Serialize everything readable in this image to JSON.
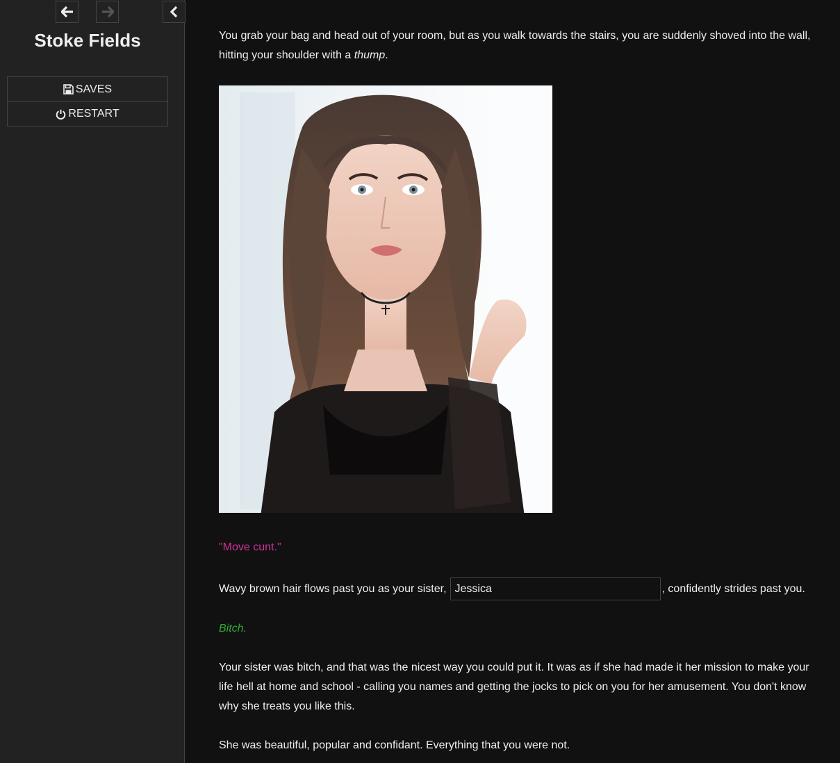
{
  "sidebar": {
    "story_title": "Stoke Fields",
    "nav": {
      "back_icon": "arrow-left-icon",
      "forward_icon": "arrow-right-icon",
      "toggle_icon": "chevron-left-icon"
    },
    "menu": [
      {
        "label": "SAVES",
        "icon": "floppy-disk-icon"
      },
      {
        "label": "RESTART",
        "icon": "power-icon"
      }
    ]
  },
  "passage": {
    "intro_before": "You grab your bag and head out of your room, but as you walk towards the stairs, you are suddenly shoved into the wall, hitting your shoulder with a ",
    "intro_emphasis": "thump",
    "intro_after": ".",
    "quote": "\"Move cunt.\"",
    "name_line_before": "Wavy brown hair flows past you as your sister,",
    "name_input_value": "Jessica",
    "name_line_after": ", confidently strides past you.",
    "thought": "Bitch.",
    "sister_paragraph": "Your sister was bitch, and that was the nicest way you could put it. It was as if she had made it her mission to make your life hell at home and school - calling you names and getting the jocks to pick on you for her amusement. You don't know why she treats you like this.",
    "last_paragraph": "She was beautiful, popular and confidant. Everything that you were not."
  },
  "colors": {
    "background": "#111111",
    "sidebar": "#222222",
    "text": "#eeeeee",
    "quote": "#cc3399",
    "thought": "#33aa33"
  }
}
